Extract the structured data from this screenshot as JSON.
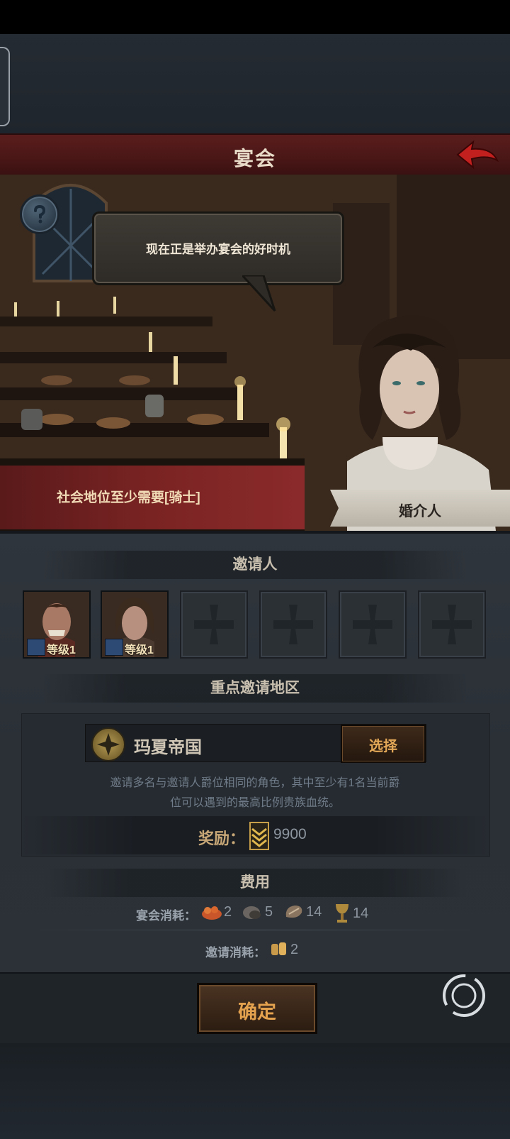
{
  "header": {
    "title": "宴会"
  },
  "scene": {
    "speech": "现在正是举办宴会的好时机",
    "requirement": "社会地位至少需要[骑士]",
    "npc_name": "婚介人"
  },
  "invitees": {
    "title": "邀请人",
    "slots": [
      {
        "filled": true,
        "level": "等级1"
      },
      {
        "filled": true,
        "level": "等级1"
      },
      {
        "filled": false
      },
      {
        "filled": false
      },
      {
        "filled": false
      },
      {
        "filled": false
      }
    ]
  },
  "region": {
    "title": "重点邀请地区",
    "name": "玛夏帝国",
    "select_label": "选择",
    "description_line1": "邀请多名与邀请人爵位相同的角色，其中至少有1名当前爵",
    "description_line2": "位可以遇到的最高比例贵族血统。",
    "reward_label": "奖励：",
    "reward_value": "9900"
  },
  "cost": {
    "title": "费用",
    "feast_label": "宴会消耗：",
    "feast_items": [
      {
        "icon": "food-icon",
        "value": "2"
      },
      {
        "icon": "bread-icon",
        "value": "5"
      },
      {
        "icon": "meat-icon",
        "value": "14"
      },
      {
        "icon": "goblet-icon",
        "value": "14"
      }
    ],
    "invite_label": "邀请消耗：",
    "invite_items": [
      {
        "icon": "grain-icon",
        "value": "2"
      }
    ]
  },
  "footer": {
    "confirm_label": "确定"
  },
  "colors": {
    "accent": "#e4a24f",
    "banner": "#7a2323",
    "panel": "#2c3137"
  }
}
